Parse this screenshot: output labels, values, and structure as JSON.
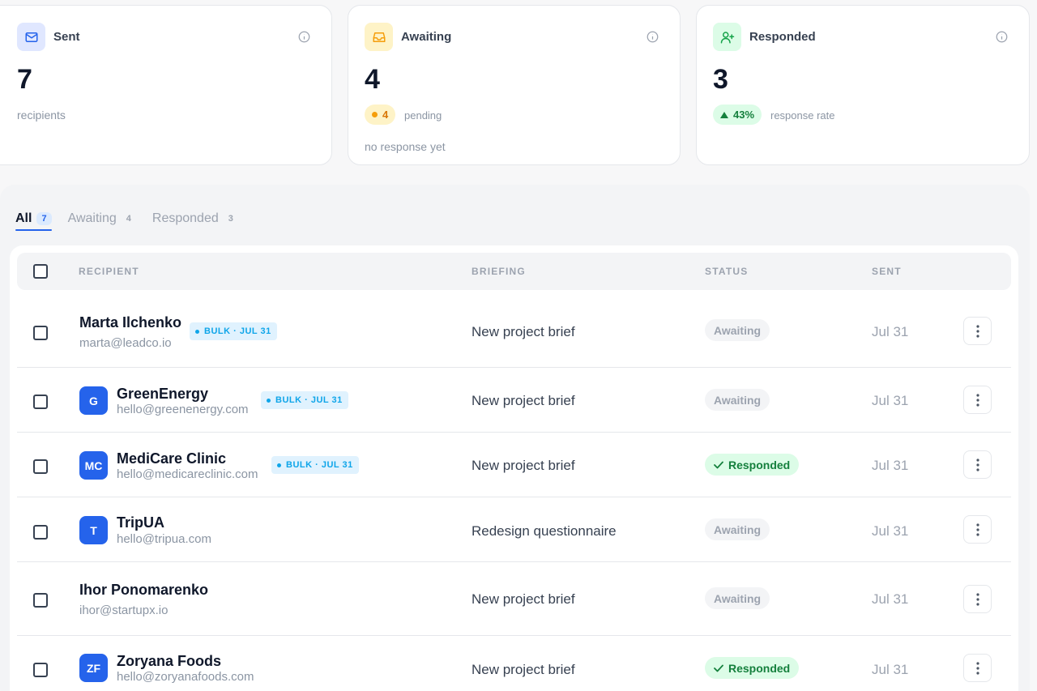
{
  "colors": {
    "accent": "#2563eb",
    "awaiting": "#f59e0b",
    "responded": "#16a34a",
    "bulk": "#0ea5e9"
  },
  "cards": {
    "sent": {
      "title": "Sent",
      "value": "7",
      "sub": "recipients",
      "icon": "mail-icon"
    },
    "awaiting": {
      "title": "Awaiting",
      "value": "4",
      "pill": "4",
      "pill_label": "pending",
      "sub": "no response yet",
      "icon": "inbox-icon"
    },
    "responded": {
      "title": "Responded",
      "value": "3",
      "pill": "43%",
      "pill_label": "response rate",
      "icon": "user-plus-icon"
    }
  },
  "tabs": [
    {
      "label": "All",
      "count": "7"
    },
    {
      "label": "Awaiting",
      "count": "4"
    },
    {
      "label": "Responded",
      "count": "3"
    }
  ],
  "table": {
    "headers": {
      "recipient": "RECIPIENT",
      "briefing": "BRIEFING",
      "status": "STATUS",
      "sent": "SENT"
    },
    "rows": [
      {
        "avatar": "",
        "name": "Marta Ilchenko",
        "email": "marta@leadco.io",
        "bulk": "BULK · JUL 31",
        "briefing": "New project brief",
        "status": "Awaiting",
        "sent": "Jul 31"
      },
      {
        "avatar": "G",
        "name": "GreenEnergy",
        "email": "hello@greenenergy.com",
        "bulk": "BULK · JUL 31",
        "briefing": "New project brief",
        "status": "Awaiting",
        "sent": "Jul 31"
      },
      {
        "avatar": "MC",
        "name": "MediCare Clinic",
        "email": "hello@medicareclinic.com",
        "bulk": "BULK · JUL 31",
        "briefing": "New project brief",
        "status": "Responded",
        "sent": "Jul 31"
      },
      {
        "avatar": "T",
        "name": "TripUA",
        "email": "hello@tripua.com",
        "bulk": "",
        "briefing": "Redesign questionnaire",
        "status": "Awaiting",
        "sent": "Jul 31"
      },
      {
        "avatar": "",
        "name": "Ihor Ponomarenko",
        "email": "ihor@startupx.io",
        "bulk": "",
        "briefing": "New project brief",
        "status": "Awaiting",
        "sent": "Jul 31"
      },
      {
        "avatar": "ZF",
        "name": "Zoryana Foods",
        "email": "hello@zoryanafoods.com",
        "bulk": "",
        "briefing": "New project brief",
        "status": "Responded",
        "sent": "Jul 31"
      }
    ]
  }
}
